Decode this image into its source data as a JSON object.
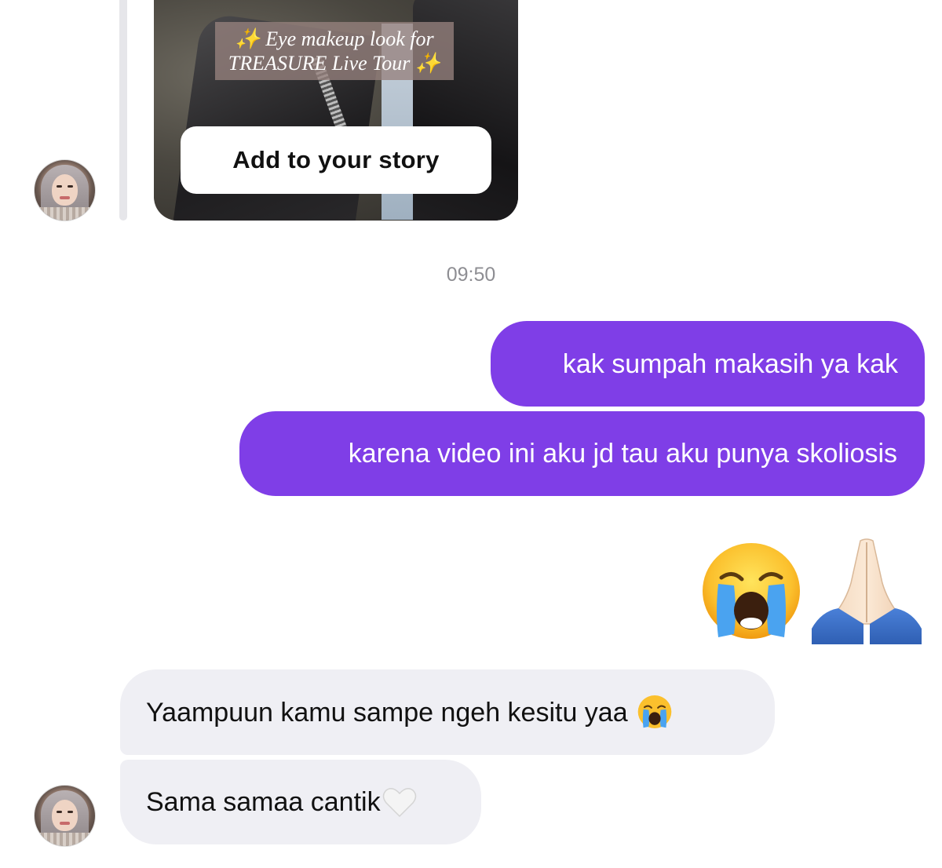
{
  "story_reply": {
    "caption_line1": "✨ Eye makeup look for",
    "caption_line2": "TREASURE Live Tour ✨",
    "button_label": "Add to your story"
  },
  "timestamp": "09:50",
  "messages": [
    {
      "direction": "outgoing",
      "text": "kak sumpah makasih ya kak"
    },
    {
      "direction": "outgoing",
      "text": "karena video ini aku jd tau aku punya skoliosis"
    },
    {
      "direction": "outgoing",
      "type": "emoji",
      "emojis": [
        "loudly-crying-face",
        "folded-hands"
      ]
    },
    {
      "direction": "incoming",
      "text": "Yaampuun kamu sampe ngeh kesitu yaa",
      "emoji": "😭"
    },
    {
      "direction": "incoming",
      "text": "Sama samaa cantik",
      "emoji": "white-heart"
    }
  ],
  "colors": {
    "outgoing_bubble": "#7f3ee7",
    "incoming_bubble": "#efeff4",
    "timestamp_text": "#8e8e93",
    "background": "#ffffff"
  }
}
